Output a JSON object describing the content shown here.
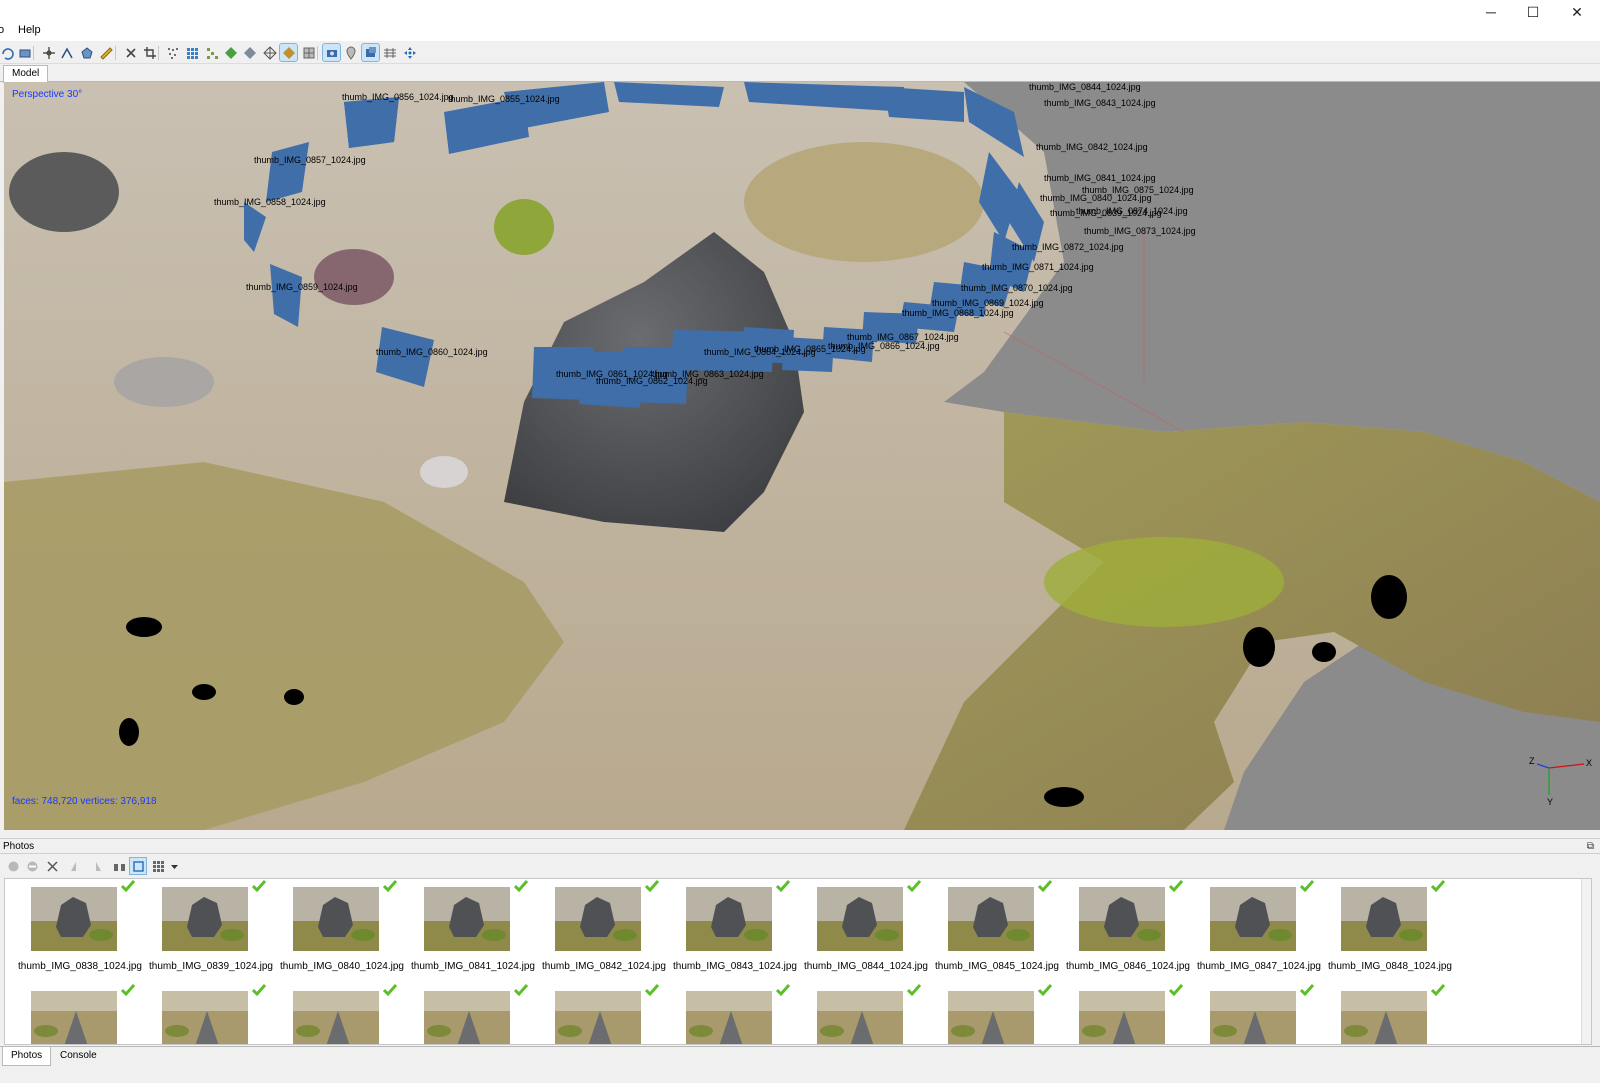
{
  "menubar": {
    "items": [
      {
        "label": "o"
      },
      {
        "label": "Help"
      }
    ],
    "window_controls": {
      "minimize": "─",
      "maximize": "☐",
      "close": "✕"
    }
  },
  "toolbar": {
    "buttons": [
      {
        "icon": "rotate-object-icon"
      },
      {
        "icon": "region-icon"
      },
      {
        "icon": "navigation-icon"
      },
      {
        "icon": "ruler-path-icon"
      },
      {
        "icon": "polygon-shape-icon"
      },
      {
        "icon": "ruler-icon"
      },
      {
        "icon": "delete-selection-icon"
      },
      {
        "icon": "crop-selection-icon"
      },
      {
        "icon": "point-cloud-icon"
      },
      {
        "icon": "dense-cloud-icon"
      },
      {
        "icon": "dense-cloud-classes-icon"
      },
      {
        "icon": "shaded-model-icon"
      },
      {
        "icon": "solid-model-icon"
      },
      {
        "icon": "wireframe-model-icon"
      },
      {
        "icon": "textured-model-icon",
        "active": true
      },
      {
        "icon": "tiled-model-icon"
      },
      {
        "icon": "show-cameras-icon",
        "active": true
      },
      {
        "icon": "show-markers-icon"
      },
      {
        "icon": "show-region-icon",
        "active": true
      },
      {
        "icon": "show-grid-icon"
      },
      {
        "icon": "reset-view-icon"
      }
    ]
  },
  "model_tab": {
    "label": "Model"
  },
  "viewport": {
    "perspective_label": "Perspective 30°",
    "stats_label": "faces: 748,720 vertices: 376,918",
    "axes": {
      "x": "X",
      "y": "Y",
      "z": "Z"
    },
    "camera_labels": [
      "thumb_IMG_0844_1024.jpg",
      "thumb_IMG_0843_1024.jpg",
      "thumb_IMG_0842_1024.jpg",
      "thumb_IMG_0841_1024.jpg",
      "thumb_IMG_0875_1024.jpg",
      "thumb_IMG_0840_1024.jpg",
      "thumb_IMG_0874_1024.jpg",
      "thumb_IMG_0873_1024.jpg",
      "thumb_IMG_0839_1024.jpg",
      "thumb_IMG_0872_1024.jpg",
      "thumb_IMG_0871_1024.jpg",
      "thumb_IMG_0870_1024.jpg",
      "thumb_IMG_0869_1024.jpg",
      "thumb_IMG_0868_1024.jpg",
      "thumb_IMG_0867_1024.jpg",
      "thumb_IMG_0866_1024.jpg",
      "thumb_IMG_0865_1024.jpg",
      "thumb_IMG_0864_1024.jpg",
      "thumb_IMG_0863_1024.jpg",
      "thumb_IMG_0862_1024.jpg",
      "thumb_IMG_0861_1024.jpg",
      "thumb_IMG_0860_1024.jpg",
      "thumb_IMG_0859_1024.jpg",
      "thumb_IMG_0858_1024.jpg",
      "thumb_IMG_0857_1024.jpg",
      "thumb_IMG_0856_1024.jpg",
      "thumb_IMG_0855_1024.jpg"
    ]
  },
  "photos_pane": {
    "title": "Photos",
    "float_icon": "⧉",
    "toolbar": [
      {
        "icon": "enable-camera-icon"
      },
      {
        "icon": "disable-camera-icon"
      },
      {
        "icon": "remove-camera-icon"
      },
      {
        "icon": "rotate-left-icon"
      },
      {
        "icon": "rotate-right-icon"
      },
      {
        "icon": "filter-icon"
      },
      {
        "icon": "reset-filter-icon",
        "active": true
      },
      {
        "icon": "view-mode-icon"
      },
      {
        "icon": "dropdown-arrow-icon"
      }
    ],
    "photos_row1": [
      {
        "label": "thumb_IMG_0838_1024.jpg",
        "aligned": true
      },
      {
        "label": "thumb_IMG_0839_1024.jpg",
        "aligned": true
      },
      {
        "label": "thumb_IMG_0840_1024.jpg",
        "aligned": true
      },
      {
        "label": "thumb_IMG_0841_1024.jpg",
        "aligned": true
      },
      {
        "label": "thumb_IMG_0842_1024.jpg",
        "aligned": true
      },
      {
        "label": "thumb_IMG_0843_1024.jpg",
        "aligned": true
      },
      {
        "label": "thumb_IMG_0844_1024.jpg",
        "aligned": true
      },
      {
        "label": "thumb_IMG_0845_1024.jpg",
        "aligned": true
      },
      {
        "label": "thumb_IMG_0846_1024.jpg",
        "aligned": true
      },
      {
        "label": "thumb_IMG_0847_1024.jpg",
        "aligned": true
      },
      {
        "label": "thumb_IMG_0848_1024.jpg",
        "aligned": true
      }
    ],
    "photos_row2_count": 11
  },
  "bottom_tabs": [
    {
      "label": "Photos",
      "active": true
    },
    {
      "label": "Console",
      "active": false
    }
  ],
  "colors": {
    "camera_plane": "#3f6ea8",
    "accent_text": "#1a39ff",
    "check_green": "#5bbf2a"
  }
}
